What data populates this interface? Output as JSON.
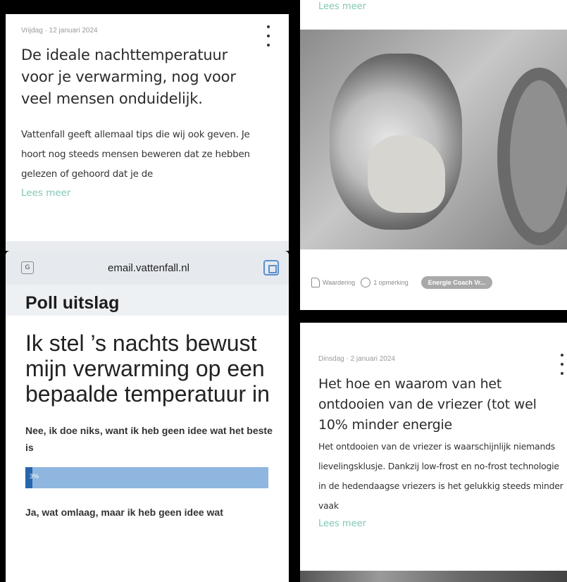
{
  "left_article": {
    "date": "Vrijdag · 12 januari 2024",
    "title": "De ideale nachttemperatuur voor je verwarming, nog voor veel mensen onduidelijk.",
    "excerpt": "Vattenfall geeft allemaal tips die wij ook geven. Je hoort nog steeds mensen beweren dat ze hebben gelezen of gehoord dat je de",
    "read_more": "Lees meer"
  },
  "browser": {
    "url": "email.vattenfall.nl",
    "left_icon": "translate-icon",
    "right_icon": "scan-icon"
  },
  "poll": {
    "title": "Poll uitslag",
    "question": "Ik stel ’s nachts bewust mijn verwarming op een bepaalde temperatuur in",
    "options": [
      {
        "label": "Nee, ik doe niks, want ik heb geen idee wat het beste is",
        "percent_label": "3%",
        "percent": 3
      },
      {
        "label": "Ja, wat omlaag, maar ik heb geen idee wat"
      }
    ],
    "colors": {
      "bar_track": "#8eb6de",
      "bar_fill": "#2766ad"
    }
  },
  "right_article_top": {
    "read_more": "Lees meer",
    "image": "washing-machine-photo",
    "actions": {
      "appreciation_label": "Waardering",
      "comment_label": "1 opmerking",
      "tag_label": "Energie Coach Vr..."
    }
  },
  "right_article": {
    "date": "Dinsdag · 2 januari 2024",
    "title": "Het hoe en waarom van het ontdooien van de vriezer (tot wel 10% minder energie",
    "excerpt": "Het ontdooien van de vriezer is waarschijnlijk niemands lievelingsklusje. Dankzij low-frost en no-frost technologie in de hedendaagse vriezers is het gelukkig steeds minder vaak",
    "read_more": "Lees meer"
  },
  "colors": {
    "accent": "#7fc7b5",
    "background": "#000000"
  }
}
